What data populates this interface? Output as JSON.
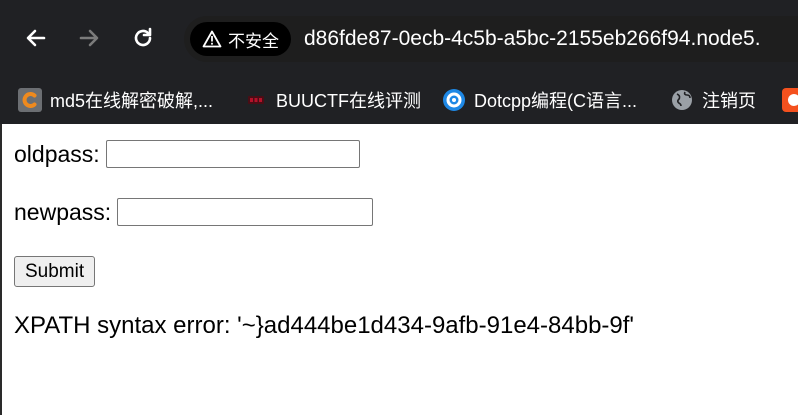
{
  "browser": {
    "security_label": "不安全",
    "url": "d86fde87-0ecb-4c5b-a5bc-2155eb266f94.node5.",
    "bookmarks": [
      {
        "label": "md5在线解密破解,...",
        "icon": "md5-site-icon",
        "color": "#ef8a1e"
      },
      {
        "label": "BUUCTF在线评测",
        "icon": "buuctf-site-icon",
        "color": "#b3122a"
      },
      {
        "label": "Dotcpp编程(C语言...",
        "icon": "dotcpp-site-icon",
        "color": "#1e88e5"
      },
      {
        "label": "注销页",
        "icon": "globe-icon",
        "color": "#9aa0a6"
      }
    ]
  },
  "form": {
    "oldpass_label": "oldpass:",
    "oldpass_value": "",
    "newpass_label": "newpass:",
    "newpass_value": "",
    "submit_label": "Submit"
  },
  "error": {
    "message": "XPATH syntax error: '~}ad444be1d434-9afb-91e4-84bb-9f'"
  }
}
